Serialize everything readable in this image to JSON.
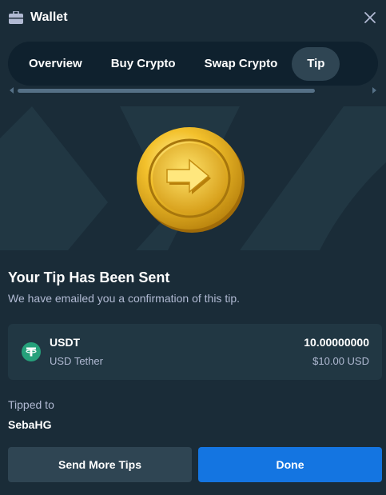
{
  "header": {
    "title": "Wallet",
    "icon": "wallet-icon",
    "close_icon": "close-icon"
  },
  "tabs": [
    {
      "label": "Overview",
      "active": false
    },
    {
      "label": "Buy Crypto",
      "active": false
    },
    {
      "label": "Swap Crypto",
      "active": false
    },
    {
      "label": "Tip",
      "active": true
    }
  ],
  "hero": {
    "icon": "coin-arrow-icon"
  },
  "confirmation": {
    "title": "Your Tip Has Been Sent",
    "subtitle": "We have emailed you a confirmation of this tip."
  },
  "currency": {
    "icon": "tether-icon",
    "code": "USDT",
    "name": "USD Tether",
    "amount": "10.00000000",
    "amount_usd": "$10.00 USD"
  },
  "recipient": {
    "label": "Tipped to",
    "username": "SebaHG"
  },
  "actions": {
    "send_more_label": "Send More Tips",
    "done_label": "Done"
  },
  "colors": {
    "background": "#1a2c38",
    "panel": "#213743",
    "tabs_bg": "#0f212e",
    "active_tab": "#2f4553",
    "primary": "#1475e1",
    "muted_text": "#b1bad3",
    "tether": "#26a17b"
  }
}
